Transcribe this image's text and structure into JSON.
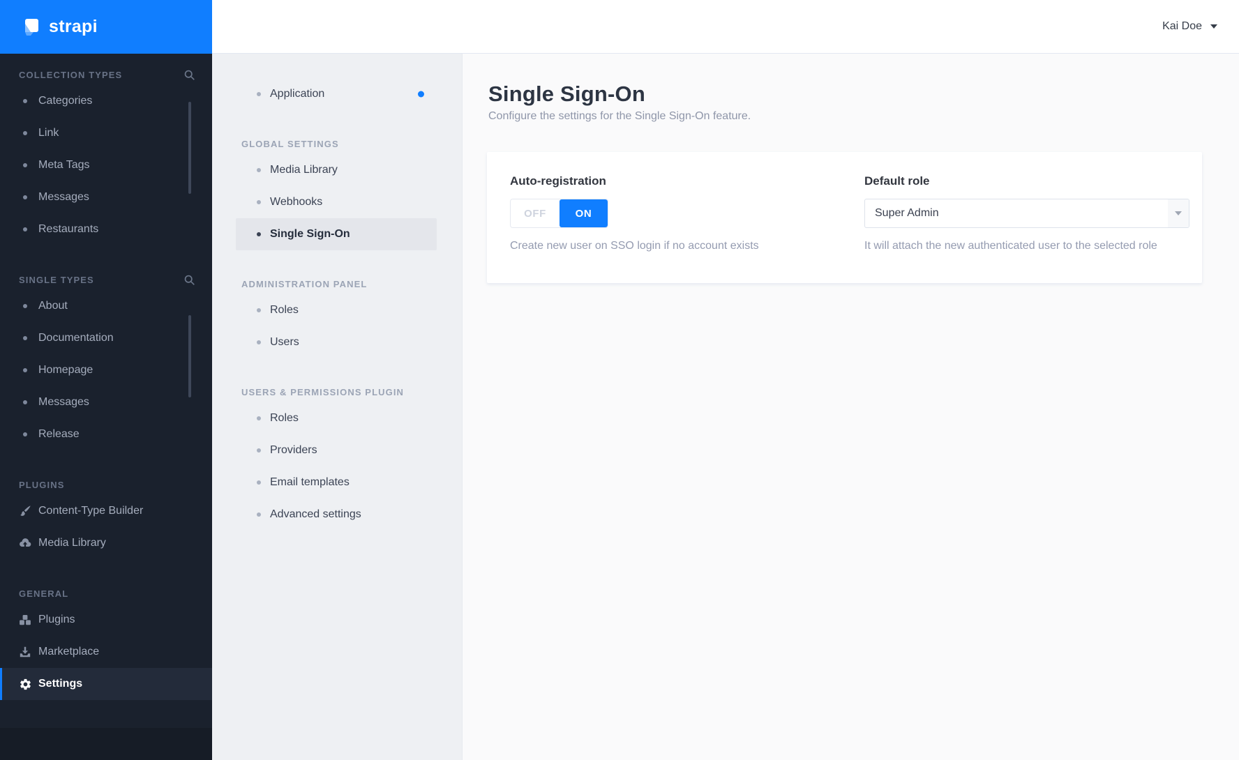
{
  "brand": {
    "name": "strapi"
  },
  "user_menu": {
    "name": "Kai Doe"
  },
  "primary_sidebar": {
    "sections": [
      {
        "title": "COLLECTION TYPES",
        "has_search": true,
        "items": [
          {
            "label": "Categories"
          },
          {
            "label": "Link"
          },
          {
            "label": "Meta Tags"
          },
          {
            "label": "Messages"
          },
          {
            "label": "Restaurants"
          }
        ]
      },
      {
        "title": "SINGLE TYPES",
        "has_search": true,
        "items": [
          {
            "label": "About"
          },
          {
            "label": "Documentation"
          },
          {
            "label": "Homepage"
          },
          {
            "label": "Messages"
          },
          {
            "label": "Release"
          }
        ]
      },
      {
        "title": "PLUGINS",
        "has_search": false,
        "items": [
          {
            "label": "Content-Type Builder",
            "icon": "paintbrush-icon"
          },
          {
            "label": "Media Library",
            "icon": "cloud-upload-icon"
          }
        ]
      },
      {
        "title": "GENERAL",
        "has_search": false,
        "items": [
          {
            "label": "Plugins",
            "icon": "cubes-icon"
          },
          {
            "label": "Marketplace",
            "icon": "download-icon"
          },
          {
            "label": "Settings",
            "icon": "gear-icon",
            "active": true
          }
        ]
      }
    ]
  },
  "settings_sidebar": {
    "top_items": [
      {
        "label": "Application",
        "notification": true
      }
    ],
    "sections": [
      {
        "title": "GLOBAL SETTINGS",
        "items": [
          {
            "label": "Media Library"
          },
          {
            "label": "Webhooks"
          },
          {
            "label": "Single Sign-On",
            "active": true
          }
        ]
      },
      {
        "title": "ADMINISTRATION PANEL",
        "items": [
          {
            "label": "Roles"
          },
          {
            "label": "Users"
          }
        ]
      },
      {
        "title": "USERS & PERMISSIONS PLUGIN",
        "items": [
          {
            "label": "Roles"
          },
          {
            "label": "Providers"
          },
          {
            "label": "Email templates"
          },
          {
            "label": "Advanced settings"
          }
        ]
      }
    ]
  },
  "page": {
    "title": "Single Sign-On",
    "subtitle": "Configure the settings for the Single Sign-On feature.",
    "auto_registration": {
      "label": "Auto-registration",
      "off_label": "OFF",
      "on_label": "ON",
      "value": "ON",
      "description": "Create new user on SSO login if no account exists"
    },
    "default_role": {
      "label": "Default role",
      "value": "Super Admin",
      "description": "It will attach the new authenticated user to the selected role"
    }
  },
  "colors": {
    "brand_blue": "#107eff",
    "sidebar_dark": "#1a212d",
    "sidebar_active_dark": "#232b3a",
    "settings_sidebar_bg": "#eef0f3",
    "main_bg": "#fafafb",
    "card_bg": "#ffffff"
  }
}
